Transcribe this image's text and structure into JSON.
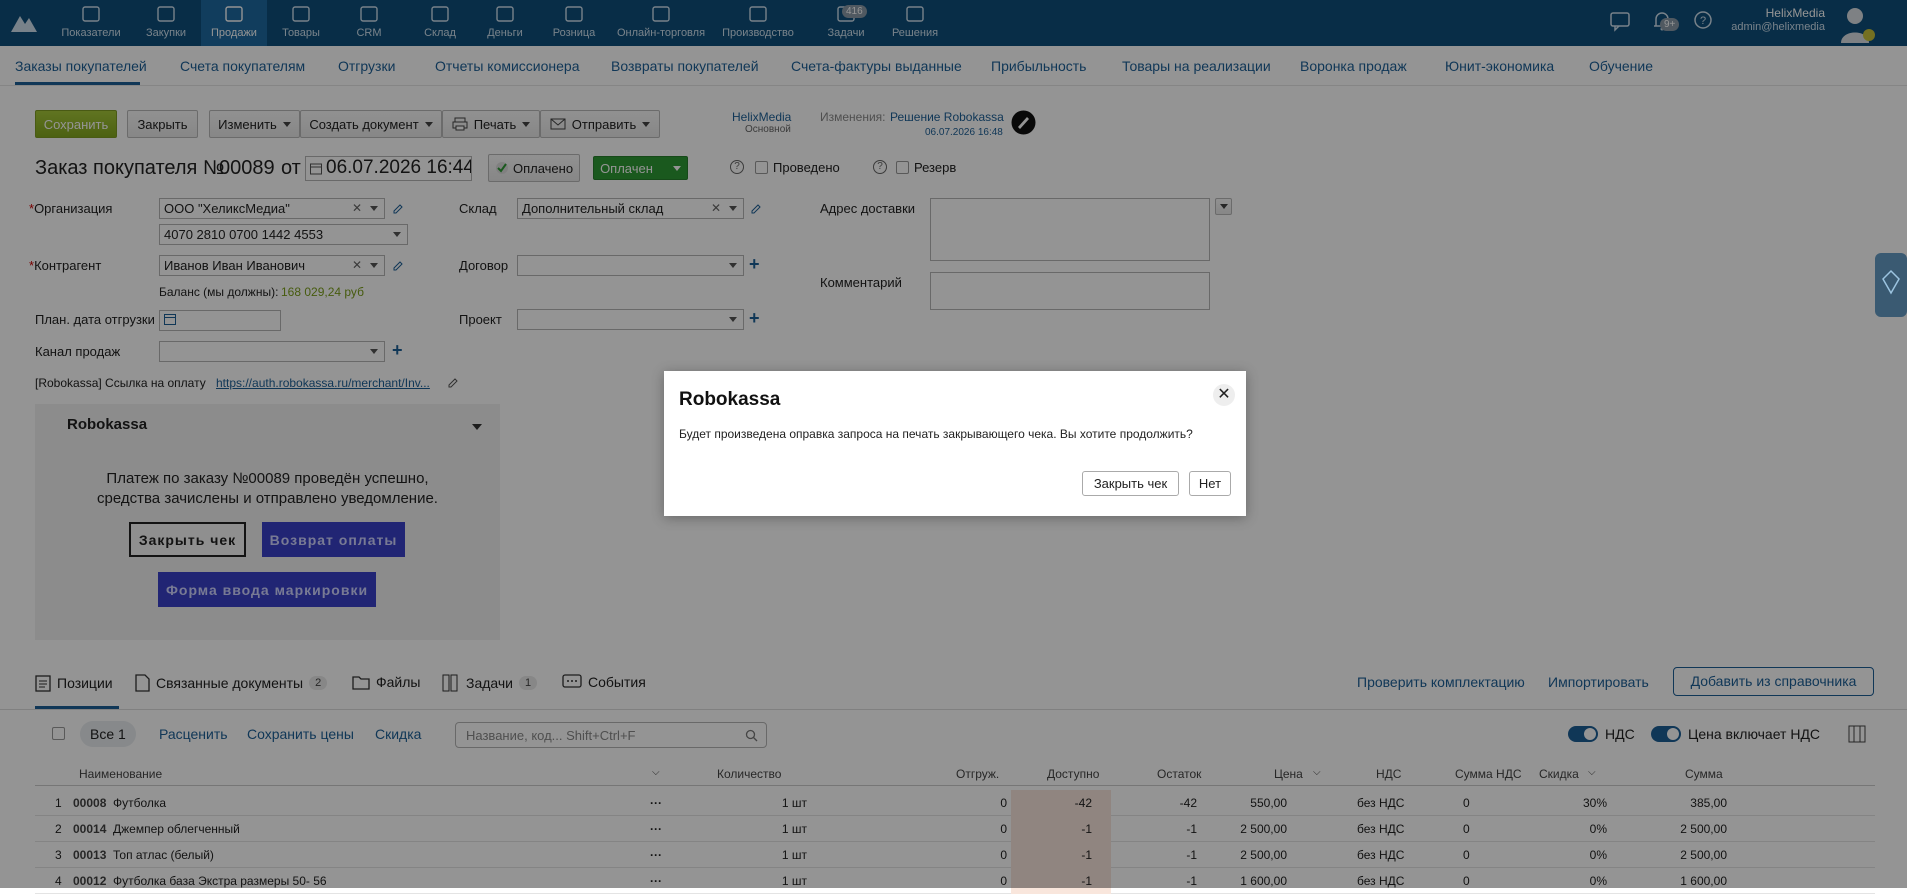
{
  "topnav": {
    "items": [
      {
        "label": "Показатели",
        "icon": "chart-icon"
      },
      {
        "label": "Закупки",
        "icon": "purchase-icon"
      },
      {
        "label": "Продажи",
        "icon": "bag-icon",
        "active": true
      },
      {
        "label": "Товары",
        "icon": "cart-icon"
      },
      {
        "label": "CRM",
        "icon": "people-icon"
      },
      {
        "label": "Склад",
        "icon": "box-icon"
      },
      {
        "label": "Деньги",
        "icon": "wallet-icon"
      },
      {
        "label": "Розница",
        "icon": "store-icon"
      },
      {
        "label": "Онлайн-торговля",
        "icon": "online-icon"
      },
      {
        "label": "Производство",
        "icon": "factory-icon"
      },
      {
        "label": "Задачи",
        "icon": "tasks-icon",
        "badge": "416"
      },
      {
        "label": "Решения",
        "icon": "apps-icon"
      }
    ],
    "notifications_badge": "9+",
    "user": {
      "name": "HelixMedia",
      "email": "admin@helixmedia"
    }
  },
  "subnav": [
    "Заказы покупателей",
    "Счета покупателям",
    "Отгрузки",
    "Отчеты комиссионера",
    "Возвраты покупателей",
    "Счета-фактуры выданные",
    "Прибыльность",
    "Товары на реализации",
    "Воронка продаж",
    "Юнит-экономика",
    "Обучение"
  ],
  "toolbar": {
    "save": "Сохранить",
    "close": "Закрыть",
    "edit": "Изменить",
    "create_doc": "Создать документ",
    "print": "Печать",
    "send": "Отправить"
  },
  "owner": {
    "name": "HelixMedia",
    "sub": "Основной",
    "changes_label": "Изменения:",
    "changes_link": "Решение Robokassa",
    "changes_date": "06.07.2026 16:48"
  },
  "doc": {
    "title": "Заказ покупателя №",
    "number": "00089",
    "from": "от",
    "date": "06.07.2026 16:44",
    "paid_btn": "Оплачено",
    "status": "Оплачен",
    "posted": "Проведено",
    "reserve": "Резерв"
  },
  "form": {
    "org_label": "Организация",
    "org_value": "ООО \"ХеликсМедиа\"",
    "account_value": "4070 2810 0700 1442 4553",
    "contractor_label": "Контрагент",
    "contractor_value": "Иванов Иван Иванович",
    "balance_label": "Баланс (мы должны):",
    "balance_value": "168 029,24 руб",
    "ship_date_label": "План. дата отгрузки",
    "channel_label": "Канал продаж",
    "warehouse_label": "Склад",
    "warehouse_value": "Дополнительный склад",
    "contract_label": "Договор",
    "project_label": "Проект",
    "address_label": "Адрес доставки",
    "comment_label": "Комментарий",
    "robo_link_label": "[Robokassa] Ссылка на оплату",
    "robo_link": "https://auth.robokassa.ru/merchant/Inv..."
  },
  "robopanel": {
    "title": "Robokassa",
    "message_line1": "Платеж по заказу №00089 проведён успешно,",
    "message_line2": "средства зачислены и отправлено уведомление.",
    "close_check": "Закрыть чек",
    "refund": "Возврат оплаты",
    "marking": "Форма ввода маркировки"
  },
  "tabs": {
    "positions": "Позиции",
    "related": "Связанные документы",
    "related_count": "2",
    "files": "Файлы",
    "tasks": "Задачи",
    "tasks_count": "1",
    "events": "События",
    "check": "Проверить комплектацию",
    "import": "Импортировать",
    "add_from_ref": "Добавить из справочника"
  },
  "filters": {
    "all": "Все 1",
    "price": "Расценить",
    "save_prices": "Сохранить цены",
    "discount": "Скидка",
    "search_placeholder": "Название, код... Shift+Ctrl+F",
    "vat": "НДС",
    "price_incl_vat": "Цена включает НДС"
  },
  "table": {
    "headers": [
      "Наименование",
      "Количество",
      "Отгруж.",
      "Доступно",
      "Остаток",
      "Цена",
      "НДС",
      "Сумма НДС",
      "Скидка",
      "Сумма"
    ],
    "rows": [
      {
        "n": "1",
        "code": "00008",
        "name": "Футболка",
        "qty": "1 шт",
        "shipped": "0",
        "avail": "-42",
        "rest": "-42",
        "price": "550,00",
        "vat": "без НДС",
        "vat_sum": "0",
        "disc": "30%",
        "sum": "385,00"
      },
      {
        "n": "2",
        "code": "00014",
        "name": "Джемпер облегченный",
        "qty": "1 шт",
        "shipped": "0",
        "avail": "-1",
        "rest": "-1",
        "price": "2 500,00",
        "vat": "без НДС",
        "vat_sum": "0",
        "disc": "0%",
        "sum": "2 500,00"
      },
      {
        "n": "3",
        "code": "00013",
        "name": "Топ атлас (белый)",
        "qty": "1 шт",
        "shipped": "0",
        "avail": "-1",
        "rest": "-1",
        "price": "2 500,00",
        "vat": "без НДС",
        "vat_sum": "0",
        "disc": "0%",
        "sum": "2 500,00"
      },
      {
        "n": "4",
        "code": "00012",
        "name": "Футболка база Экстра размеры 50- 56",
        "qty": "1 шт",
        "shipped": "0",
        "avail": "-1",
        "rest": "-1",
        "price": "1 600,00",
        "vat": "без НДС",
        "vat_sum": "0",
        "disc": "0%",
        "sum": "1 600,00"
      }
    ]
  },
  "dialog": {
    "title": "Robokassa",
    "text": "Будет произведена оправка запроса на печать закрывающего чека. Вы хотите продолжить?",
    "confirm": "Закрыть чек",
    "cancel": "Нет"
  }
}
